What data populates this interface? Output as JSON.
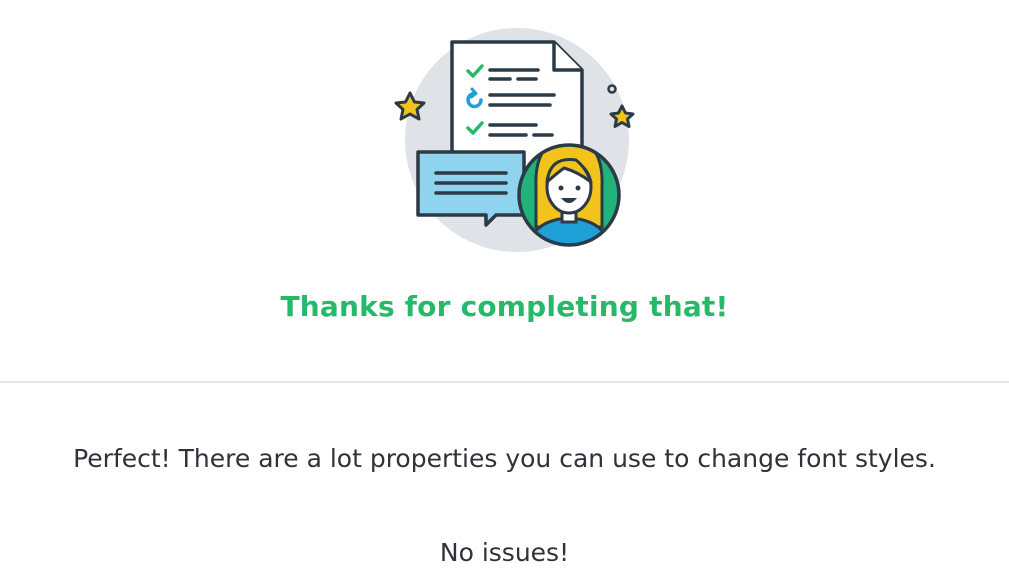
{
  "completion": {
    "title": "Thanks for completing that!",
    "title_color": "#26b96a",
    "illustration_icon": "checklist-with-avatar-illustration"
  },
  "feedback": {
    "message": "Perfect! There are a lot properties you can use to change font styles.",
    "status": "No issues!"
  }
}
